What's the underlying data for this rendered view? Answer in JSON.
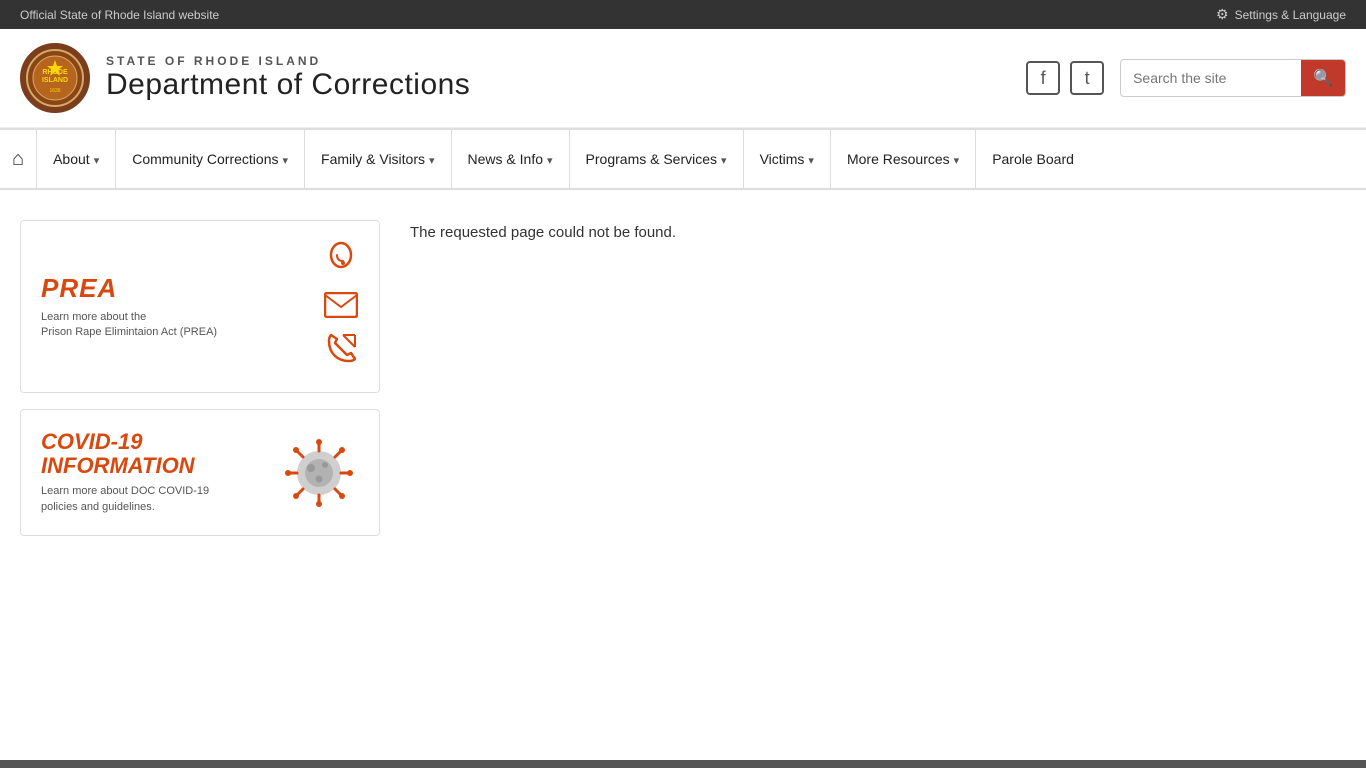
{
  "topbar": {
    "official_text": "Official State of Rhode Island website",
    "settings_label": "Settings & Language"
  },
  "header": {
    "state_label": "STATE OF RHODE ISLAND",
    "dept_title": "Department of Corrections",
    "search_placeholder": "Search the site"
  },
  "social": {
    "facebook_label": "Facebook",
    "twitter_label": "Twitter"
  },
  "nav": {
    "home_label": "Home",
    "about_label": "About",
    "community_corrections_label": "Community Corrections",
    "family_visitors_label": "Family & Visitors",
    "news_info_label": "News & Info",
    "programs_services_label": "Programs & Services",
    "victims_label": "Victims",
    "more_resources_label": "More Resources",
    "parole_board_label": "Parole Board"
  },
  "cards": {
    "prea": {
      "title": "PREA",
      "subtitle": "Learn more about the\nPrison Rape Elimintaion Act (PREA)"
    },
    "covid": {
      "title_line1": "COVID-19",
      "title_line2": "INFORMATION",
      "subtitle": "Learn more about DOC COVID-19\npolicies and guidelines."
    }
  },
  "main": {
    "error_message": "The requested page could not be found."
  }
}
